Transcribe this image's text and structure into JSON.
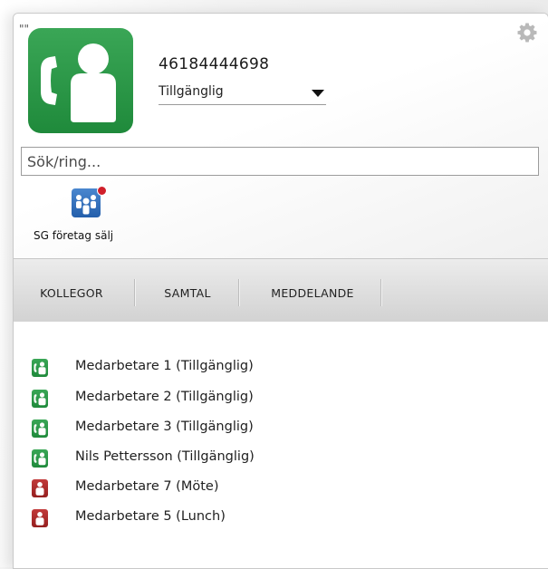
{
  "header": {
    "quote_mark": "\"\"",
    "user_avatar_icon": "phone-person-icon",
    "avatar_color": "#2a9a47",
    "phone_number": "46184444698",
    "status_select": {
      "value": "Tillgänglig"
    },
    "settings_icon": "gear-icon"
  },
  "search": {
    "placeholder": "Sök/ring..."
  },
  "group": {
    "label": "SG företag sälj",
    "icon": "group-people-icon",
    "badge_color": "#d01f2a"
  },
  "tabs": [
    {
      "label": "KOLLEGOR"
    },
    {
      "label": "SAMTAL"
    },
    {
      "label": "MEDDELANDE"
    }
  ],
  "contacts": [
    {
      "name": "Medarbetare 1 (Tillgänglig)",
      "status": "available",
      "icon": "phone-person-icon"
    },
    {
      "name": "Medarbetare 2 (Tillgänglig)",
      "status": "available",
      "icon": "phone-person-icon"
    },
    {
      "name": "Medarbetare 3 (Tillgänglig)",
      "status": "available",
      "icon": "phone-person-icon"
    },
    {
      "name": "Nils Pettersson (Tillgänglig)",
      "status": "available",
      "icon": "phone-person-icon"
    },
    {
      "name": "Medarbetare 7 (Möte)",
      "status": "busy",
      "icon": "person-icon"
    },
    {
      "name": "Medarbetare 5 (Lunch)",
      "status": "busy",
      "icon": "person-icon"
    }
  ],
  "colors": {
    "available": "#2a9a47",
    "busy": "#b32a2a",
    "group_blue": "#2f6fbf"
  }
}
